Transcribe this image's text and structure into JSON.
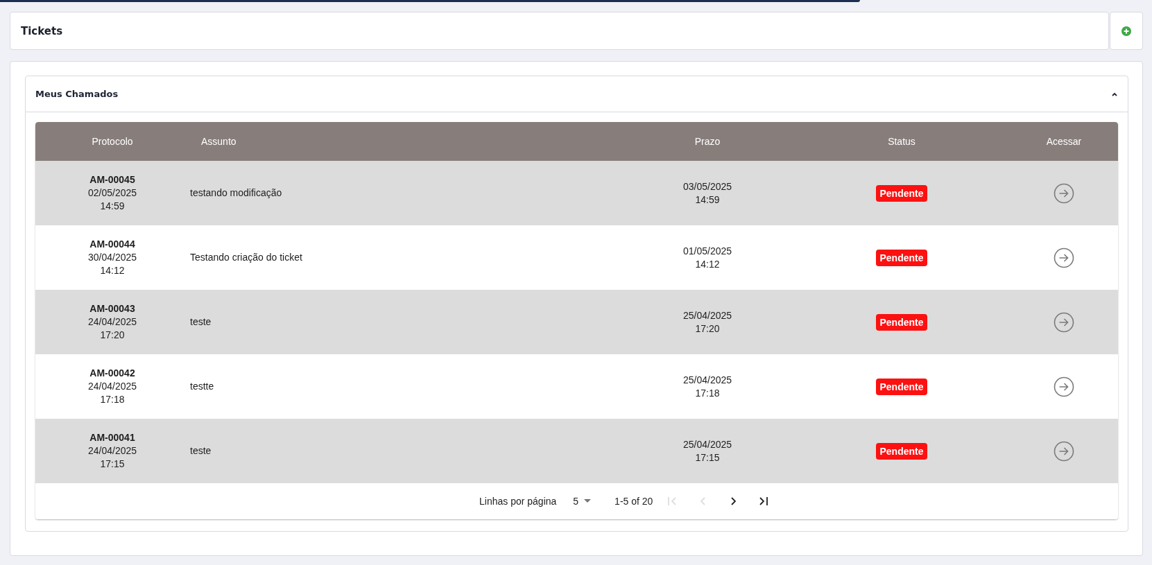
{
  "header": {
    "title": "Tickets"
  },
  "panel": {
    "title": "Meus Chamados",
    "expanded": true
  },
  "table": {
    "columns": [
      "Protocolo",
      "Assunto",
      "Prazo",
      "Status",
      "Acessar"
    ],
    "rows": [
      {
        "protocol": "AM-00045",
        "date": "02/05/2025",
        "time": "14:59",
        "subject": "testando modificação",
        "due_date": "03/05/2025",
        "due_time": "14:59",
        "status": "Pendente"
      },
      {
        "protocol": "AM-00044",
        "date": "30/04/2025",
        "time": "14:12",
        "subject": "Testando criação do ticket",
        "due_date": "01/05/2025",
        "due_time": "14:12",
        "status": "Pendente"
      },
      {
        "protocol": "AM-00043",
        "date": "24/04/2025",
        "time": "17:20",
        "subject": "teste",
        "due_date": "25/04/2025",
        "due_time": "17:20",
        "status": "Pendente"
      },
      {
        "protocol": "AM-00042",
        "date": "24/04/2025",
        "time": "17:18",
        "subject": "testte",
        "due_date": "25/04/2025",
        "due_time": "17:18",
        "status": "Pendente"
      },
      {
        "protocol": "AM-00041",
        "date": "24/04/2025",
        "time": "17:15",
        "subject": "teste",
        "due_date": "25/04/2025",
        "due_time": "17:15",
        "status": "Pendente"
      }
    ]
  },
  "pagination": {
    "rows_label": "Linhas por página",
    "rows_per_page": "5",
    "range": "1-5 of 20",
    "buttons": [
      {
        "kind": "first",
        "disabled": true
      },
      {
        "kind": "prev",
        "disabled": true
      },
      {
        "kind": "next",
        "disabled": false
      },
      {
        "kind": "last",
        "disabled": false
      }
    ]
  }
}
